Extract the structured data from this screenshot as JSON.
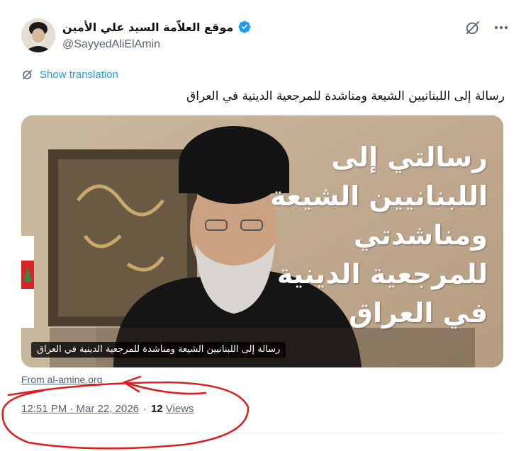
{
  "author": {
    "display_name": "موقع العلاّمة السيد علي الأمين",
    "handle": "@SayyedAliElAmin",
    "verified_color": "#1d9bf0"
  },
  "actions": {
    "grok_icon": "grok-icon",
    "more_icon": "more-icon"
  },
  "translation": {
    "label": "Show translation"
  },
  "tweet": {
    "text": "رسالة إلى اللبنانيين الشيعة ومناشدة للمرجعية الدينية في العراق"
  },
  "media": {
    "overlay_text": "رسالتي إلى\nاللبنانيين الشيعة\nومناشدتي\nللمرجعية الدينية\nفي العراق",
    "caption": "رسالة إلى اللبنانيين الشيعة ومناشدة للمرجعية الدينية في العراق"
  },
  "source": {
    "label": "From al-amine.org"
  },
  "meta": {
    "time": "12:51 PM · Mar 22, 2026",
    "separator": "·",
    "views_count": "12",
    "views_label": "Views"
  },
  "colors": {
    "link": "#1d9bf0",
    "secondary": "#536471",
    "annotation": "#e01b1b"
  }
}
